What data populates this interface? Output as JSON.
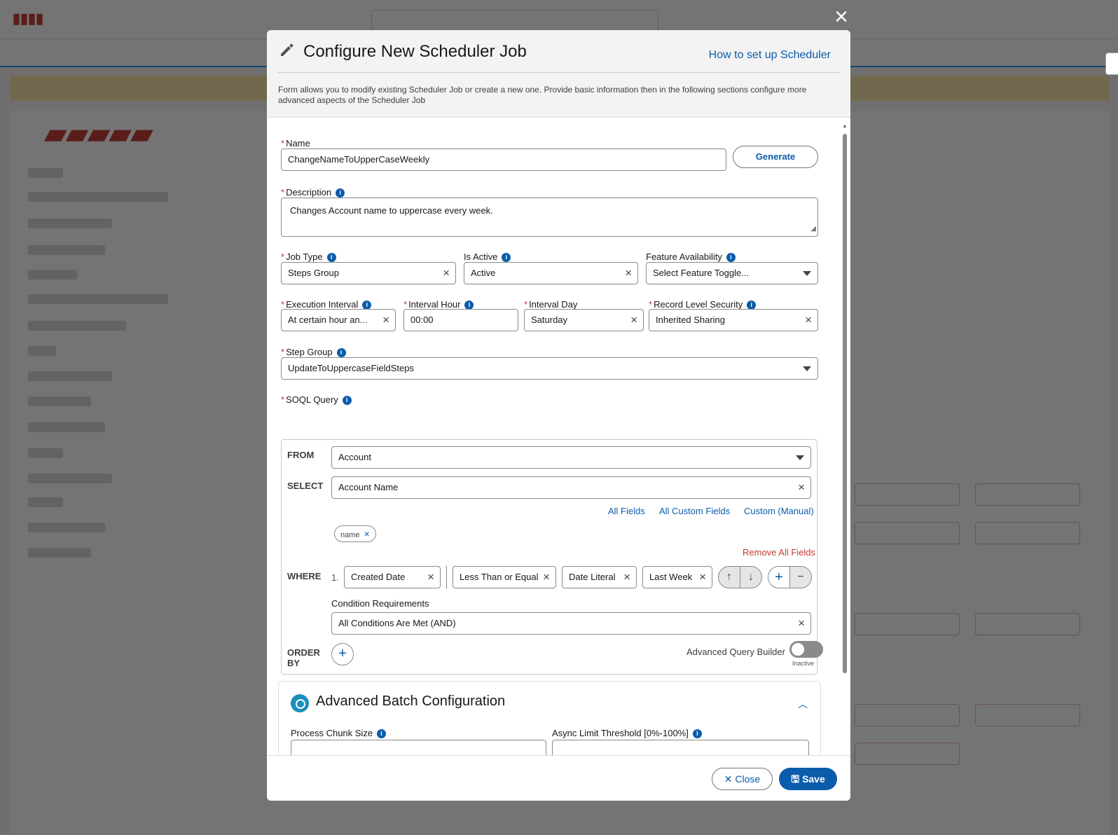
{
  "modal": {
    "title": "Configure New Scheduler Job",
    "help_link": "How to set up Scheduler",
    "intro": "Form allows you to modify existing Scheduler Job or create a new one. Provide basic information then in the following sections configure more advanced aspects of the Scheduler Job"
  },
  "fields": {
    "name": {
      "label": "Name",
      "value": "ChangeNameToUpperCaseWeekly",
      "generate_label": "Generate"
    },
    "description": {
      "label": "Description",
      "value": "Changes Account name to uppercase every week."
    },
    "job_type": {
      "label": "Job Type",
      "value": "Steps Group"
    },
    "is_active": {
      "label": "Is Active",
      "value": "Active"
    },
    "feature_availability": {
      "label": "Feature Availability",
      "placeholder": "Select Feature Toggle..."
    },
    "execution_interval": {
      "label": "Execution Interval",
      "value": "At certain hour an..."
    },
    "interval_hour": {
      "label": "Interval Hour",
      "value": "00:00"
    },
    "interval_day": {
      "label": "Interval Day",
      "value": "Saturday"
    },
    "record_level_security": {
      "label": "Record Level Security",
      "value": "Inherited Sharing"
    },
    "step_group": {
      "label": "Step Group",
      "value": "UpdateToUppercaseFieldSteps"
    }
  },
  "soql": {
    "label": "SOQL Query",
    "from_label": "FROM",
    "from_value": "Account",
    "select_label": "SELECT",
    "select_value": "Account Name",
    "links": [
      "All Fields",
      "All Custom Fields",
      "Custom (Manual)"
    ],
    "selected_fields": [
      "name"
    ],
    "remove_all": "Remove All Fields",
    "where_label": "WHERE",
    "condition": {
      "index": "1.",
      "field": "Created Date",
      "operator": "Less Than or Equal",
      "value_type": "Date Literal",
      "value": "Last Week"
    },
    "condition_requirements_label": "Condition Requirements",
    "condition_requirements_value": "All Conditions Are Met (AND)",
    "order_label_1": "ORDER",
    "order_label_2": "BY"
  },
  "advanced_query_builder": {
    "label": "Advanced Query Builder",
    "state": "Inactive"
  },
  "batch": {
    "title": "Advanced Batch Configuration",
    "chunk_label": "Process Chunk Size",
    "async_label": "Async Limit Threshold [0%-100%]"
  },
  "footer": {
    "close": "Close",
    "save": "Save"
  },
  "colors": {
    "brand": "#0b5cab",
    "required": "#c23934",
    "overlay": "#444444"
  }
}
